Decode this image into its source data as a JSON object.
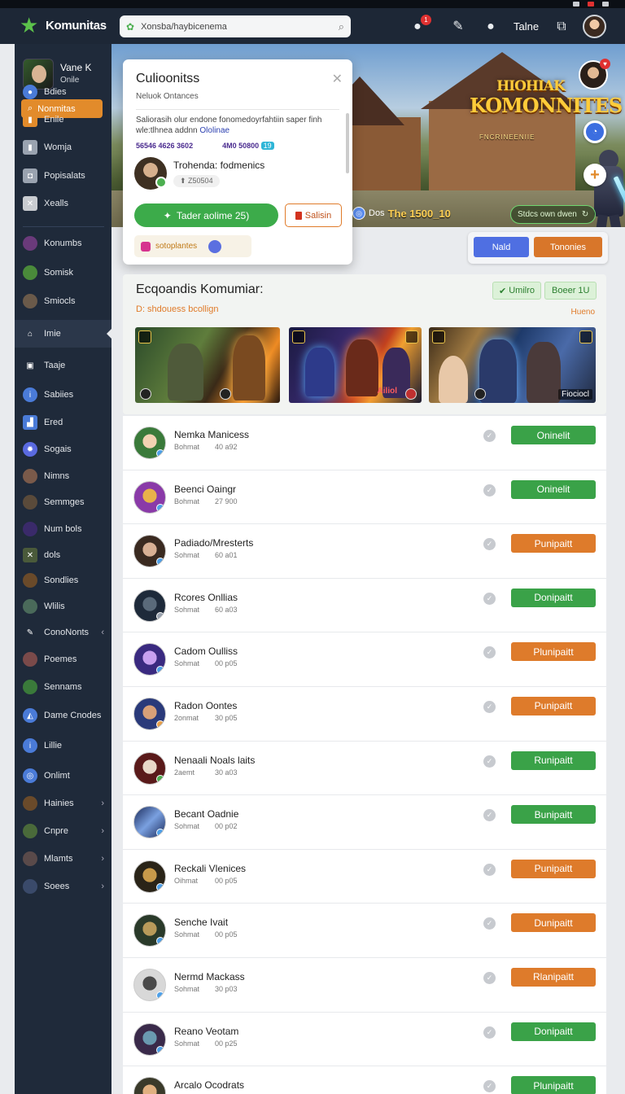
{
  "app": {
    "brand": "Komunitas"
  },
  "topbar": {
    "search_value": "Xonsba/haybicenema",
    "notification_count": "1",
    "label": "Talne"
  },
  "sidebar": {
    "profile": {
      "name": "Vane K",
      "status": "Onile"
    },
    "active_item": "Nonmitas",
    "items": [
      {
        "label": "Bdies",
        "icon": "user-icon"
      },
      {
        "label": "Enile",
        "icon": "bolt-icon"
      },
      {
        "label": "Womja",
        "icon": "book-icon"
      },
      {
        "label": "Popisalats",
        "icon": "camera-icon"
      },
      {
        "label": "Xealls",
        "icon": "crossed-swords-icon"
      },
      {
        "label": "Konumbs",
        "icon": "game-avatar-icon"
      },
      {
        "label": "Somisk",
        "icon": "game-avatar-icon"
      },
      {
        "label": "Smiocls",
        "icon": "game-avatar-icon"
      },
      {
        "label": "Imie",
        "icon": "home-icon"
      },
      {
        "label": "Taaje",
        "icon": "gift-icon"
      },
      {
        "label": "Sabiies",
        "icon": "info-icon"
      },
      {
        "label": "Ered",
        "icon": "chart-icon"
      },
      {
        "label": "Sogais",
        "icon": "gear-icon"
      },
      {
        "label": "Nimns",
        "icon": "game-avatar-icon"
      },
      {
        "label": "Semmges",
        "icon": "game-avatar-icon"
      },
      {
        "label": "Num bols",
        "icon": "game-avatar-icon"
      },
      {
        "label": "dols",
        "icon": "crossed-swords-icon"
      },
      {
        "label": "Sondlies",
        "icon": "game-avatar-icon"
      },
      {
        "label": "Wlilis",
        "icon": "game-avatar-icon"
      },
      {
        "label": "ConoNonts",
        "icon": "wrench-icon"
      },
      {
        "label": "Poemes",
        "icon": "game-avatar-icon"
      },
      {
        "label": "Sennams",
        "icon": "game-avatar-icon"
      },
      {
        "label": "Dame Cnodes",
        "icon": "compass-icon"
      },
      {
        "label": "Lillie",
        "icon": "info-icon"
      },
      {
        "label": "Onlimt",
        "icon": "globe-icon"
      },
      {
        "label": "Hainies",
        "icon": "game-avatar-icon"
      },
      {
        "label": "Cnpre",
        "icon": "game-avatar-icon"
      },
      {
        "label": "Mlamts",
        "icon": "game-avatar-icon"
      },
      {
        "label": "Soees",
        "icon": "game-avatar-icon"
      }
    ]
  },
  "hero": {
    "title": "HIOHIAK\nKOMONNITES",
    "subtitle": "FNCRINEENIIE",
    "badge_label": "Dos",
    "currency": "The 1500_10",
    "pill_label": "Stdcs own dwen"
  },
  "popup": {
    "title": "Culioonitss",
    "subtitle": "Neluok Ontances",
    "desc_a": "Saliorasih olur endone fonomedoyrfahtiin saper finh wle:tlhnea addnn ",
    "desc_b": "Ololinae",
    "num1": "56546 4626 3602",
    "num2": "4M0 50800",
    "num_tag": "19",
    "member_name": "Trohenda: fodmenics",
    "member_chip": "Z50504",
    "primary_button": "Tader aolime 25)",
    "secondary_button": "Salisin",
    "footer_label": "sotoplantes"
  },
  "hero_buttons": {
    "left": "Nald",
    "right": "Tononies"
  },
  "featured": {
    "title": "Ecqoandis Komumiar:",
    "subtitle": "D: shdouess bcollign",
    "chip1": "Umilro",
    "chip2": "Boeer 1U",
    "more": "Hueno",
    "thumb_labels": [
      "",
      "Ailiol",
      "Fiociocl"
    ]
  },
  "members": [
    {
      "name": "Nemka Manicess",
      "m1": "Bohmat",
      "m2": "40 a92",
      "action": "Oninelit",
      "color": "green"
    },
    {
      "name": "Beenci Oaingr",
      "m1": "Bohmat",
      "m2": "27 900",
      "action": "Oninelit",
      "color": "green"
    },
    {
      "name": "Padiado/Mresterts",
      "m1": "Sohmat",
      "m2": "60 a01",
      "action": "Punipaitt",
      "color": "orange"
    },
    {
      "name": "Rcores Onllias",
      "m1": "Sohmat",
      "m2": "60 a03",
      "action": "Donipaitt",
      "color": "green"
    },
    {
      "name": "Cadom Oulliss",
      "m1": "Sohmat",
      "m2": "00 p05",
      "action": "Plunipaitt",
      "color": "orange"
    },
    {
      "name": "Radon Oontes",
      "m1": "2onmat",
      "m2": "30 p05",
      "action": "Punipaitt",
      "color": "orange"
    },
    {
      "name": "Nenaali Noals laits",
      "m1": "2aemt",
      "m2": "30 a03",
      "action": "Runipaitt",
      "color": "green"
    },
    {
      "name": "Becant Oadnie",
      "m1": "Sohmat",
      "m2": "00 p02",
      "action": "Bunipaitt",
      "color": "green"
    },
    {
      "name": "Reckali Vlenices",
      "m1": "Oihmat",
      "m2": "00 p05",
      "action": "Punipaitt",
      "color": "orange"
    },
    {
      "name": "Senche Ivait",
      "m1": "Sohmat",
      "m2": "00 p05",
      "action": "Dunipaitt",
      "color": "orange"
    },
    {
      "name": "Nermd Mackass",
      "m1": "Sohmat",
      "m2": "30 p03",
      "action": "Rlanipaitt",
      "color": "orange"
    },
    {
      "name": "Reano Veotam",
      "m1": "Sohmat",
      "m2": "00 p25",
      "action": "Donipaitt",
      "color": "green"
    },
    {
      "name": "Arcalo Ocodrats",
      "m1": "",
      "m2": "",
      "action": "Plunipaitt",
      "color": "green"
    }
  ],
  "colors": {
    "accent": "#e28b2b",
    "green": "#3aa248",
    "orange": "#de7b2b",
    "sidebar": "#1f2a3a",
    "topbar": "#1d2736"
  }
}
